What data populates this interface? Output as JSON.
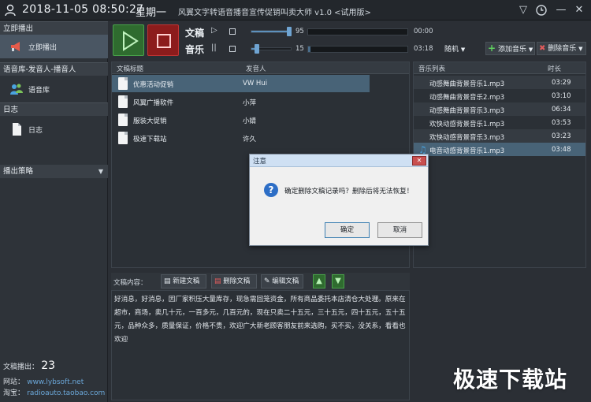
{
  "header": {
    "datetime": "2018-11-05 08:50:27",
    "weekday": "星期一",
    "app_title": "风翼文字转语音播音宣传促销叫卖大师 v1.0 <试用版>"
  },
  "sidebar": {
    "section1_title": "立即播出",
    "broadcast_label": "立即播出",
    "section2_title": "语音库-发音人-播音人",
    "voice_library_label": "语音库",
    "section3_title": "日志",
    "log_label": "日志",
    "strategy_title": "播出策略",
    "text_count_label": "文稿播出：",
    "text_count": "23",
    "website_label": "网站：",
    "website": "www.lybsoft.net",
    "taobao_label": "淘宝：",
    "taobao": "radioauto.taobao.com"
  },
  "controls": {
    "text_label": "文稿",
    "music_label": "音乐",
    "text_volume": "95",
    "text_volume_fraction": 0.95,
    "music_volume": "15",
    "music_volume_fraction": 0.15,
    "text_time": "00:00",
    "music_time": "03:18",
    "text_progress_fraction": 0.0,
    "music_progress_fraction": 0.02,
    "random_label": "随机",
    "add_music_label": "添加音乐",
    "delete_music_label": "删除音乐"
  },
  "list": {
    "col_title": "文稿标题",
    "col_speaker": "发音人",
    "rows": [
      {
        "title": "优惠活动促销",
        "speaker": "VW Hui",
        "selected": true
      },
      {
        "title": "风翼广播软件",
        "speaker": "小萍",
        "selected": false
      },
      {
        "title": "服装大促销",
        "speaker": "小婧",
        "selected": false
      },
      {
        "title": "极速下载站",
        "speaker": "许久",
        "selected": false
      }
    ]
  },
  "music": {
    "col_title": "音乐列表",
    "col_duration": "时长",
    "rows": [
      {
        "name": "动感舞曲背景音乐1.mp3",
        "duration": "03:29"
      },
      {
        "name": "动感舞曲背景音乐2.mp3",
        "duration": "03:10"
      },
      {
        "name": "动感舞曲背景音乐3.mp3",
        "duration": "06:34"
      },
      {
        "name": "欢快动感背景音乐1.mp3",
        "duration": "03:53"
      },
      {
        "name": "欢快动感背景音乐3.mp3",
        "duration": "03:23"
      },
      {
        "name": "电音动感背景音乐1.mp3",
        "duration": "03:48"
      }
    ]
  },
  "editor": {
    "content_label": "文稿内容：",
    "new_label": "新建文稿",
    "delete_label": "删除文稿",
    "edit_label": "编辑文稿",
    "text": "好消息，好消息，因厂家积压大量库存，现急需回笼资金，所有商品委托本店清仓大处理。原来在超市，商场，卖几十元，一百多元，几百元的，现在只卖二十五元，三十五元，四十五元，五十五元，品种众多，质量保证，价格不贵，欢迎广大新老顾客朋友前来选购，买不买，没关系，看看也欢迎"
  },
  "dialog": {
    "title": "注意",
    "message": "确定删除文稿记录吗？删除后将无法恢复！",
    "ok": "确定",
    "cancel": "取消"
  },
  "watermark": "极速下载站"
}
